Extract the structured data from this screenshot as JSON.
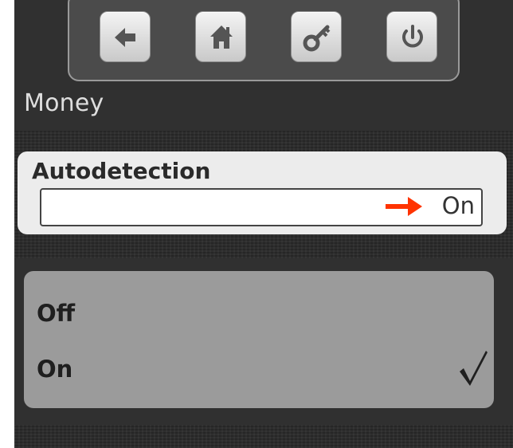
{
  "header": {
    "title": "Money",
    "toolbar": [
      {
        "name": "back-button",
        "icon": "arrow-left-icon"
      },
      {
        "name": "home-button",
        "icon": "home-icon"
      },
      {
        "name": "key-button",
        "icon": "key-icon"
      },
      {
        "name": "power-button",
        "icon": "power-icon"
      }
    ]
  },
  "setting": {
    "label": "Autodetection",
    "value": "On",
    "indicator_icon": "arrow-right-icon",
    "indicator_color": "#ff3300"
  },
  "options": [
    {
      "label": "Off",
      "selected": false
    },
    {
      "label": "On",
      "selected": true
    }
  ],
  "selected_mark_icon": "checkmark-icon"
}
